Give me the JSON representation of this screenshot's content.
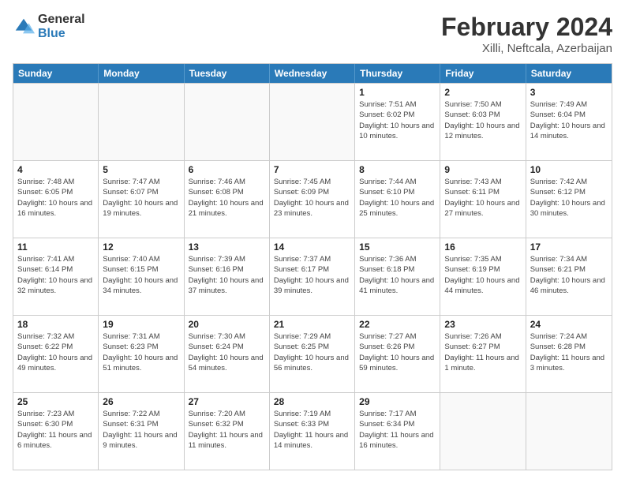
{
  "logo": {
    "general": "General",
    "blue": "Blue"
  },
  "title": "February 2024",
  "subtitle": "Xilli, Neftcala, Azerbaijan",
  "weekdays": [
    "Sunday",
    "Monday",
    "Tuesday",
    "Wednesday",
    "Thursday",
    "Friday",
    "Saturday"
  ],
  "weeks": [
    [
      {
        "day": "",
        "info": ""
      },
      {
        "day": "",
        "info": ""
      },
      {
        "day": "",
        "info": ""
      },
      {
        "day": "",
        "info": ""
      },
      {
        "day": "1",
        "info": "Sunrise: 7:51 AM\nSunset: 6:02 PM\nDaylight: 10 hours and 10 minutes."
      },
      {
        "day": "2",
        "info": "Sunrise: 7:50 AM\nSunset: 6:03 PM\nDaylight: 10 hours and 12 minutes."
      },
      {
        "day": "3",
        "info": "Sunrise: 7:49 AM\nSunset: 6:04 PM\nDaylight: 10 hours and 14 minutes."
      }
    ],
    [
      {
        "day": "4",
        "info": "Sunrise: 7:48 AM\nSunset: 6:05 PM\nDaylight: 10 hours and 16 minutes."
      },
      {
        "day": "5",
        "info": "Sunrise: 7:47 AM\nSunset: 6:07 PM\nDaylight: 10 hours and 19 minutes."
      },
      {
        "day": "6",
        "info": "Sunrise: 7:46 AM\nSunset: 6:08 PM\nDaylight: 10 hours and 21 minutes."
      },
      {
        "day": "7",
        "info": "Sunrise: 7:45 AM\nSunset: 6:09 PM\nDaylight: 10 hours and 23 minutes."
      },
      {
        "day": "8",
        "info": "Sunrise: 7:44 AM\nSunset: 6:10 PM\nDaylight: 10 hours and 25 minutes."
      },
      {
        "day": "9",
        "info": "Sunrise: 7:43 AM\nSunset: 6:11 PM\nDaylight: 10 hours and 27 minutes."
      },
      {
        "day": "10",
        "info": "Sunrise: 7:42 AM\nSunset: 6:12 PM\nDaylight: 10 hours and 30 minutes."
      }
    ],
    [
      {
        "day": "11",
        "info": "Sunrise: 7:41 AM\nSunset: 6:14 PM\nDaylight: 10 hours and 32 minutes."
      },
      {
        "day": "12",
        "info": "Sunrise: 7:40 AM\nSunset: 6:15 PM\nDaylight: 10 hours and 34 minutes."
      },
      {
        "day": "13",
        "info": "Sunrise: 7:39 AM\nSunset: 6:16 PM\nDaylight: 10 hours and 37 minutes."
      },
      {
        "day": "14",
        "info": "Sunrise: 7:37 AM\nSunset: 6:17 PM\nDaylight: 10 hours and 39 minutes."
      },
      {
        "day": "15",
        "info": "Sunrise: 7:36 AM\nSunset: 6:18 PM\nDaylight: 10 hours and 41 minutes."
      },
      {
        "day": "16",
        "info": "Sunrise: 7:35 AM\nSunset: 6:19 PM\nDaylight: 10 hours and 44 minutes."
      },
      {
        "day": "17",
        "info": "Sunrise: 7:34 AM\nSunset: 6:21 PM\nDaylight: 10 hours and 46 minutes."
      }
    ],
    [
      {
        "day": "18",
        "info": "Sunrise: 7:32 AM\nSunset: 6:22 PM\nDaylight: 10 hours and 49 minutes."
      },
      {
        "day": "19",
        "info": "Sunrise: 7:31 AM\nSunset: 6:23 PM\nDaylight: 10 hours and 51 minutes."
      },
      {
        "day": "20",
        "info": "Sunrise: 7:30 AM\nSunset: 6:24 PM\nDaylight: 10 hours and 54 minutes."
      },
      {
        "day": "21",
        "info": "Sunrise: 7:29 AM\nSunset: 6:25 PM\nDaylight: 10 hours and 56 minutes."
      },
      {
        "day": "22",
        "info": "Sunrise: 7:27 AM\nSunset: 6:26 PM\nDaylight: 10 hours and 59 minutes."
      },
      {
        "day": "23",
        "info": "Sunrise: 7:26 AM\nSunset: 6:27 PM\nDaylight: 11 hours and 1 minute."
      },
      {
        "day": "24",
        "info": "Sunrise: 7:24 AM\nSunset: 6:28 PM\nDaylight: 11 hours and 3 minutes."
      }
    ],
    [
      {
        "day": "25",
        "info": "Sunrise: 7:23 AM\nSunset: 6:30 PM\nDaylight: 11 hours and 6 minutes."
      },
      {
        "day": "26",
        "info": "Sunrise: 7:22 AM\nSunset: 6:31 PM\nDaylight: 11 hours and 9 minutes."
      },
      {
        "day": "27",
        "info": "Sunrise: 7:20 AM\nSunset: 6:32 PM\nDaylight: 11 hours and 11 minutes."
      },
      {
        "day": "28",
        "info": "Sunrise: 7:19 AM\nSunset: 6:33 PM\nDaylight: 11 hours and 14 minutes."
      },
      {
        "day": "29",
        "info": "Sunrise: 7:17 AM\nSunset: 6:34 PM\nDaylight: 11 hours and 16 minutes."
      },
      {
        "day": "",
        "info": ""
      },
      {
        "day": "",
        "info": ""
      }
    ]
  ]
}
